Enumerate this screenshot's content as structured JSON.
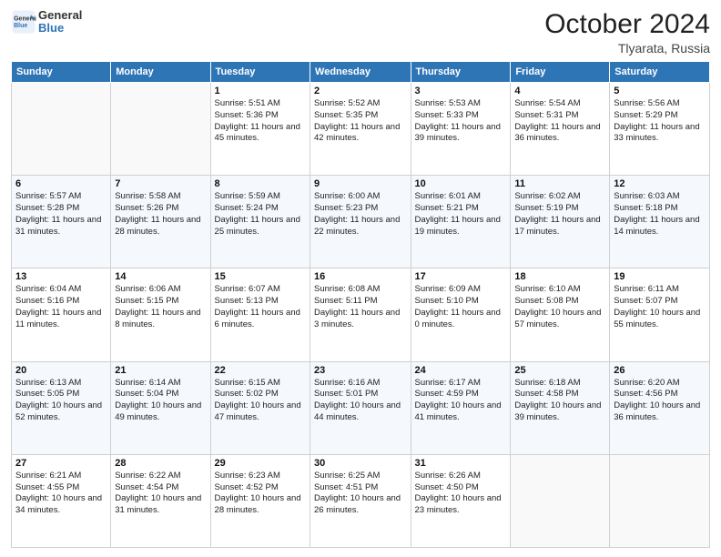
{
  "header": {
    "logo_line1": "General",
    "logo_line2": "Blue",
    "month": "October 2024",
    "location": "Tlyarata, Russia"
  },
  "weekdays": [
    "Sunday",
    "Monday",
    "Tuesday",
    "Wednesday",
    "Thursday",
    "Friday",
    "Saturday"
  ],
  "weeks": [
    [
      {
        "day": "",
        "info": ""
      },
      {
        "day": "",
        "info": ""
      },
      {
        "day": "1",
        "info": "Sunrise: 5:51 AM\nSunset: 5:36 PM\nDaylight: 11 hours and 45 minutes."
      },
      {
        "day": "2",
        "info": "Sunrise: 5:52 AM\nSunset: 5:35 PM\nDaylight: 11 hours and 42 minutes."
      },
      {
        "day": "3",
        "info": "Sunrise: 5:53 AM\nSunset: 5:33 PM\nDaylight: 11 hours and 39 minutes."
      },
      {
        "day": "4",
        "info": "Sunrise: 5:54 AM\nSunset: 5:31 PM\nDaylight: 11 hours and 36 minutes."
      },
      {
        "day": "5",
        "info": "Sunrise: 5:56 AM\nSunset: 5:29 PM\nDaylight: 11 hours and 33 minutes."
      }
    ],
    [
      {
        "day": "6",
        "info": "Sunrise: 5:57 AM\nSunset: 5:28 PM\nDaylight: 11 hours and 31 minutes."
      },
      {
        "day": "7",
        "info": "Sunrise: 5:58 AM\nSunset: 5:26 PM\nDaylight: 11 hours and 28 minutes."
      },
      {
        "day": "8",
        "info": "Sunrise: 5:59 AM\nSunset: 5:24 PM\nDaylight: 11 hours and 25 minutes."
      },
      {
        "day": "9",
        "info": "Sunrise: 6:00 AM\nSunset: 5:23 PM\nDaylight: 11 hours and 22 minutes."
      },
      {
        "day": "10",
        "info": "Sunrise: 6:01 AM\nSunset: 5:21 PM\nDaylight: 11 hours and 19 minutes."
      },
      {
        "day": "11",
        "info": "Sunrise: 6:02 AM\nSunset: 5:19 PM\nDaylight: 11 hours and 17 minutes."
      },
      {
        "day": "12",
        "info": "Sunrise: 6:03 AM\nSunset: 5:18 PM\nDaylight: 11 hours and 14 minutes."
      }
    ],
    [
      {
        "day": "13",
        "info": "Sunrise: 6:04 AM\nSunset: 5:16 PM\nDaylight: 11 hours and 11 minutes."
      },
      {
        "day": "14",
        "info": "Sunrise: 6:06 AM\nSunset: 5:15 PM\nDaylight: 11 hours and 8 minutes."
      },
      {
        "day": "15",
        "info": "Sunrise: 6:07 AM\nSunset: 5:13 PM\nDaylight: 11 hours and 6 minutes."
      },
      {
        "day": "16",
        "info": "Sunrise: 6:08 AM\nSunset: 5:11 PM\nDaylight: 11 hours and 3 minutes."
      },
      {
        "day": "17",
        "info": "Sunrise: 6:09 AM\nSunset: 5:10 PM\nDaylight: 11 hours and 0 minutes."
      },
      {
        "day": "18",
        "info": "Sunrise: 6:10 AM\nSunset: 5:08 PM\nDaylight: 10 hours and 57 minutes."
      },
      {
        "day": "19",
        "info": "Sunrise: 6:11 AM\nSunset: 5:07 PM\nDaylight: 10 hours and 55 minutes."
      }
    ],
    [
      {
        "day": "20",
        "info": "Sunrise: 6:13 AM\nSunset: 5:05 PM\nDaylight: 10 hours and 52 minutes."
      },
      {
        "day": "21",
        "info": "Sunrise: 6:14 AM\nSunset: 5:04 PM\nDaylight: 10 hours and 49 minutes."
      },
      {
        "day": "22",
        "info": "Sunrise: 6:15 AM\nSunset: 5:02 PM\nDaylight: 10 hours and 47 minutes."
      },
      {
        "day": "23",
        "info": "Sunrise: 6:16 AM\nSunset: 5:01 PM\nDaylight: 10 hours and 44 minutes."
      },
      {
        "day": "24",
        "info": "Sunrise: 6:17 AM\nSunset: 4:59 PM\nDaylight: 10 hours and 41 minutes."
      },
      {
        "day": "25",
        "info": "Sunrise: 6:18 AM\nSunset: 4:58 PM\nDaylight: 10 hours and 39 minutes."
      },
      {
        "day": "26",
        "info": "Sunrise: 6:20 AM\nSunset: 4:56 PM\nDaylight: 10 hours and 36 minutes."
      }
    ],
    [
      {
        "day": "27",
        "info": "Sunrise: 6:21 AM\nSunset: 4:55 PM\nDaylight: 10 hours and 34 minutes."
      },
      {
        "day": "28",
        "info": "Sunrise: 6:22 AM\nSunset: 4:54 PM\nDaylight: 10 hours and 31 minutes."
      },
      {
        "day": "29",
        "info": "Sunrise: 6:23 AM\nSunset: 4:52 PM\nDaylight: 10 hours and 28 minutes."
      },
      {
        "day": "30",
        "info": "Sunrise: 6:25 AM\nSunset: 4:51 PM\nDaylight: 10 hours and 26 minutes."
      },
      {
        "day": "31",
        "info": "Sunrise: 6:26 AM\nSunset: 4:50 PM\nDaylight: 10 hours and 23 minutes."
      },
      {
        "day": "",
        "info": ""
      },
      {
        "day": "",
        "info": ""
      }
    ]
  ]
}
